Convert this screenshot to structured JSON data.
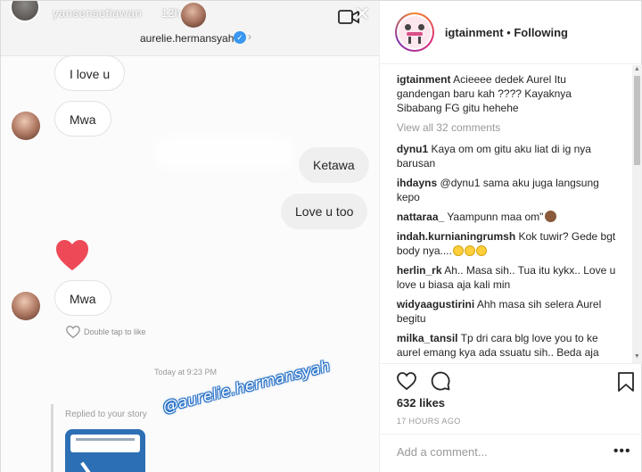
{
  "story": {
    "username": "yansensetiawan",
    "time": "12h",
    "peer_name": "aurelie.hermansyah",
    "messages": [
      {
        "text": "I love u"
      },
      {
        "text": "Mwa"
      },
      {
        "text": "Ketawa"
      },
      {
        "text": "Love u too"
      },
      {
        "text": "Mwa"
      }
    ],
    "double_tap": "Double tap to like",
    "today": "Today at 9:23 PM",
    "replied": "Replied to your story",
    "mention": "@aurelie.hermansyah",
    "colors": {
      "heart": "#ed4956",
      "verified": "#3897f0",
      "mention_outline": "#2a73c8"
    }
  },
  "post": {
    "account": "igtainment",
    "separator": " • ",
    "follow_state": "Following",
    "caption_user": "igtainment",
    "caption_text": "Acieeee dedek Aurel Itu gandengan baru kah ???? Kayaknya Sibabang FG gitu hehehe",
    "view_all": "View all 32 comments",
    "comments": [
      {
        "user": "dynu1",
        "text": "Kaya om om gitu aku liat di ig nya barusan"
      },
      {
        "user": "ihdayns",
        "text": "@dynu1 sama aku juga langsung kepo"
      },
      {
        "user": "nattaraa_",
        "text": "Yaampunn maa om\""
      },
      {
        "user": "indah.kurnianingrumsh",
        "text": "Kok tuwir? Gede bgt body nya...."
      },
      {
        "user": "herlin_rk",
        "text": "Ah.. Masa sih.. Tua itu kykx.. Love u love u biasa aja kali min"
      },
      {
        "user": "widyaagustirini",
        "text": "Ahh masa sih selera Aurel begitu"
      },
      {
        "user": "milka_tansil",
        "text": "Tp dri cara blg love you to ke aurel emang kya ada ssuatu sih.. Beda aja"
      }
    ],
    "likes": "632 likes",
    "ago": "17 HOURS AGO",
    "add_comment_placeholder": "Add a comment...",
    "more": "•••"
  }
}
